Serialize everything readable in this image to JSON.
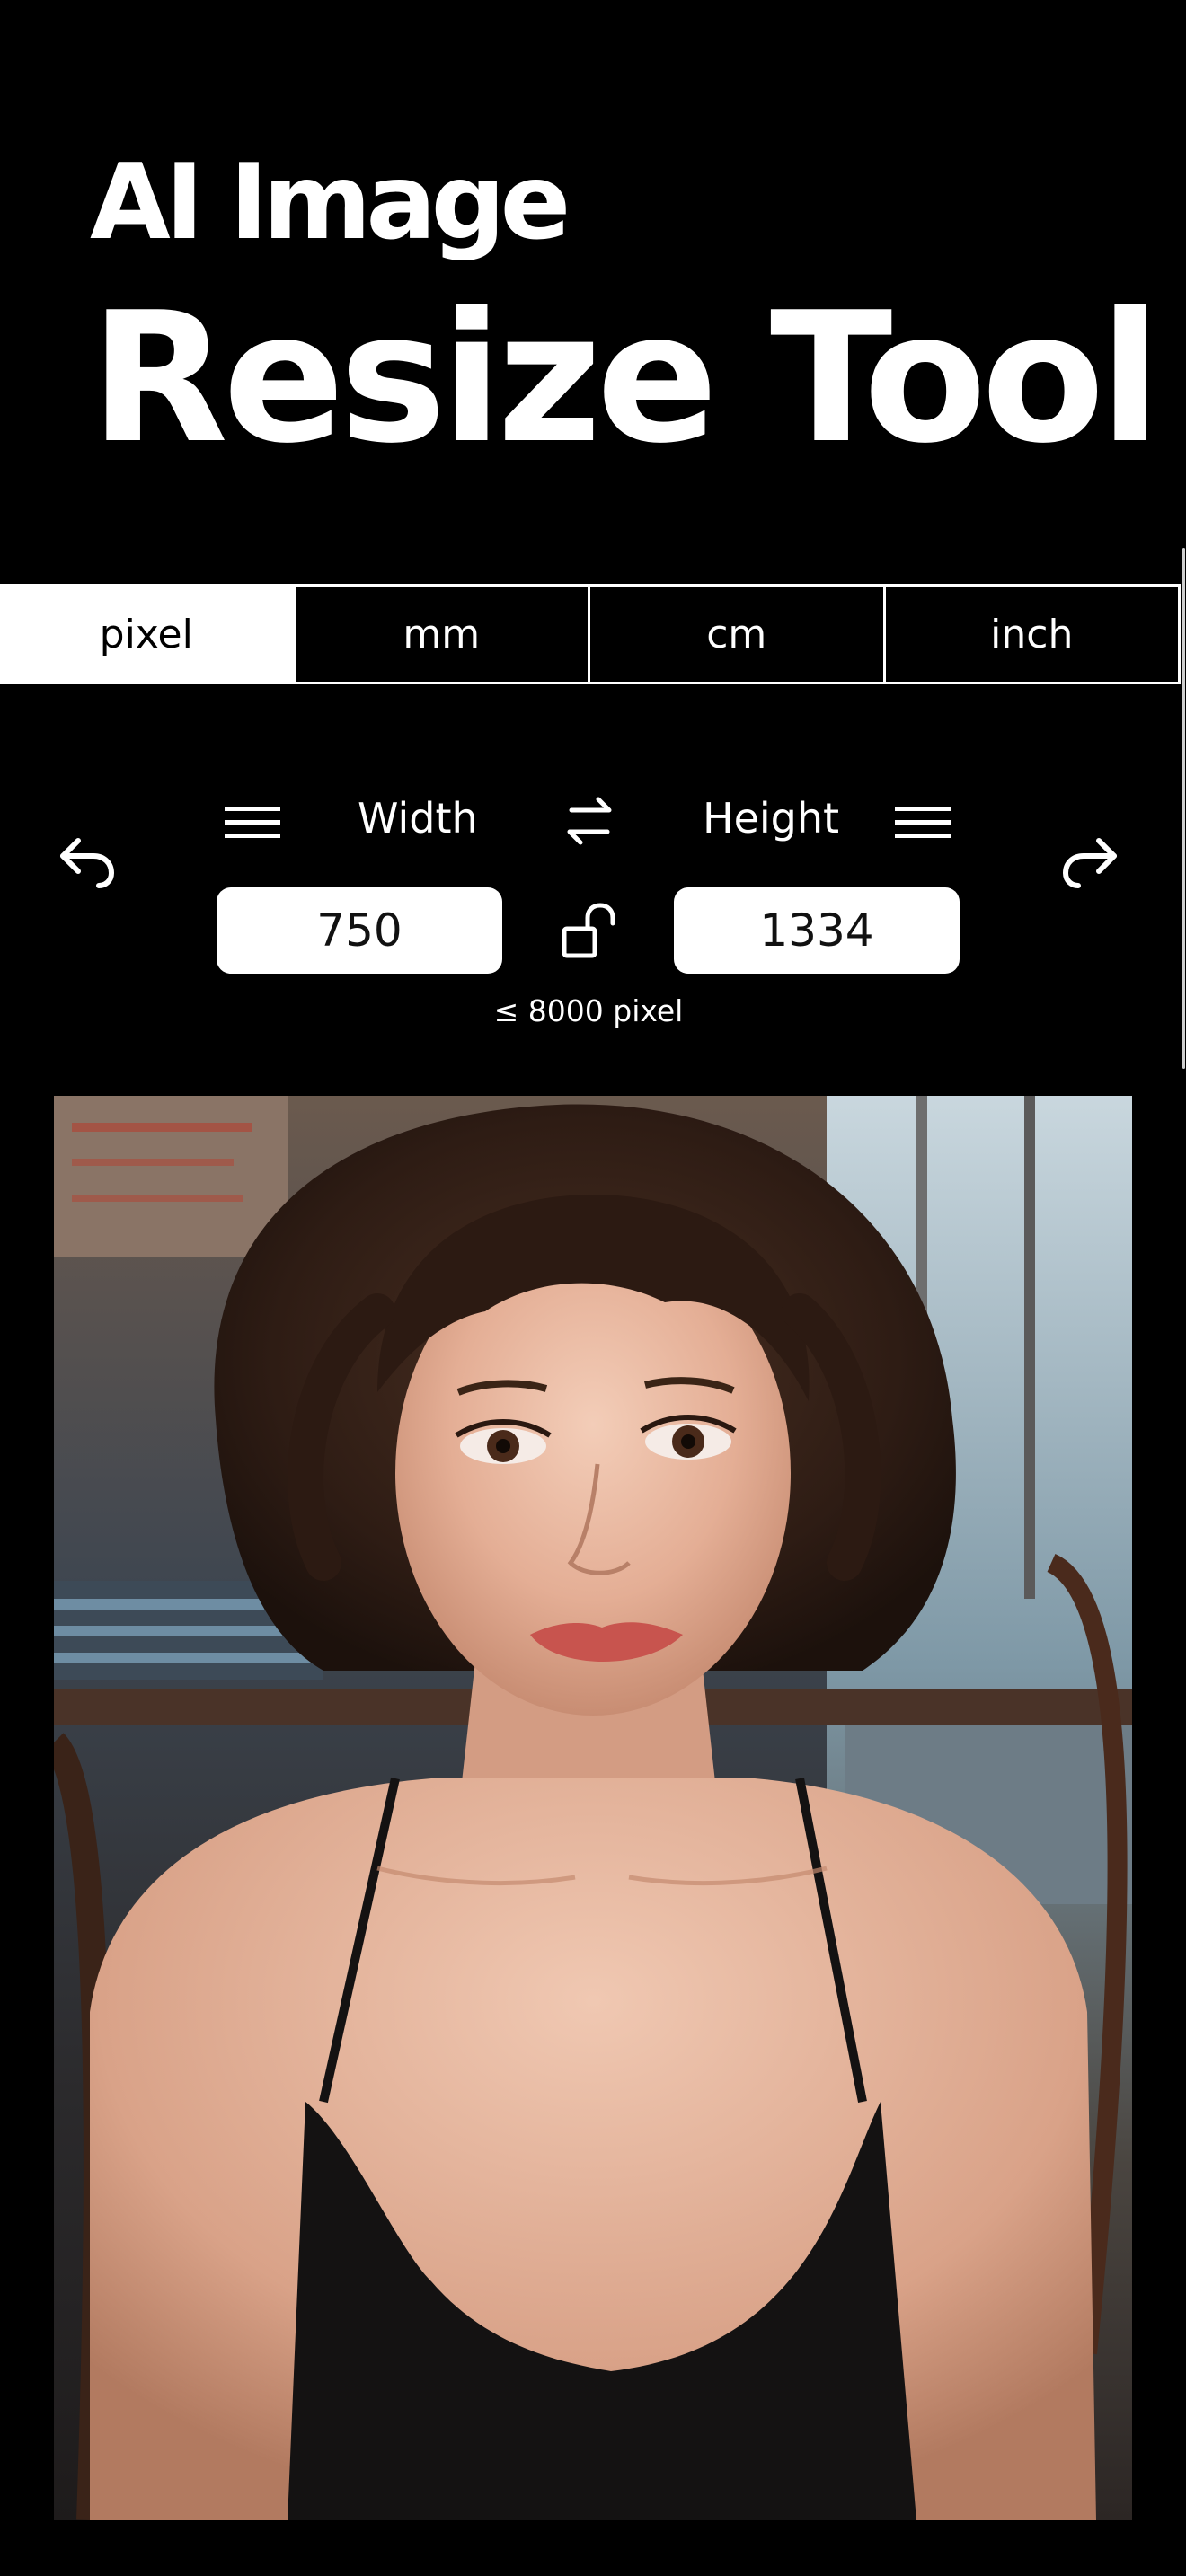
{
  "hero": {
    "line1": "AI Image",
    "line2": "Resize Tool"
  },
  "units": {
    "tabs": [
      {
        "label": "pixel",
        "active": true
      },
      {
        "label": "mm",
        "active": false
      },
      {
        "label": "cm",
        "active": false
      },
      {
        "label": "inch",
        "active": false
      }
    ]
  },
  "dimensions": {
    "width_label": "Width",
    "height_label": "Height",
    "width_value": "750",
    "height_value": "1334",
    "limit_note": "≤ 8000 pixel",
    "aspect_locked": false
  },
  "icons": {
    "undo": "undo-icon",
    "redo": "redo-icon",
    "width_menu": "menu-icon",
    "height_menu": "menu-icon",
    "swap": "swap-arrows-icon",
    "lock": "unlocked-padlock-icon"
  },
  "photo": {
    "alt": "Portrait photo of a young woman with short wavy brown hair in a black camisole, seated in a café"
  }
}
